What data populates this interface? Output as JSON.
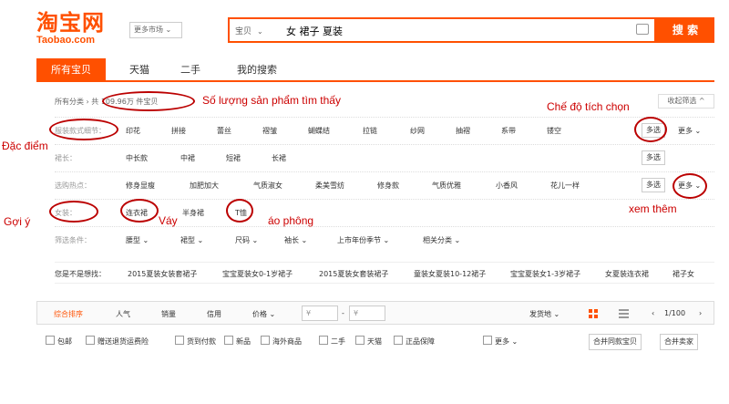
{
  "logo": {
    "cn": "淘宝网",
    "en": "Taobao.com"
  },
  "header": {
    "market": "更多市场 ⌄"
  },
  "search": {
    "category": "宝贝",
    "chevron": "⌄",
    "query": "女 裙子 夏装",
    "button": "搜 索"
  },
  "tabs": [
    "所有宝贝",
    "天猫",
    "二手",
    "我的搜索"
  ],
  "breadcrumb": {
    "all": "所有分类 ›",
    "count": "共 109.96万 件宝贝"
  },
  "collapse": "收起筛选 ^",
  "rows": {
    "r1": {
      "label": "服装款式细节：",
      "options": [
        "印花",
        "拼接",
        "蕾丝",
        "褶皱",
        "蝴蝶结",
        "拉链",
        "纱网",
        "抽褶",
        "系带",
        "镂空"
      ],
      "multi": "多选",
      "more": "更多 ⌄"
    },
    "r2": {
      "label": "裙长：",
      "options": [
        "中长款",
        "中裙",
        "短裙",
        "长裙"
      ],
      "multi": "多选"
    },
    "r3": {
      "label": "选购热点：",
      "options": [
        "修身显瘦",
        "加肥加大",
        "气质淑女",
        "柔美雪纺",
        "修身款",
        "气质优雅",
        "小香风",
        "花儿一样"
      ],
      "multi": "多选",
      "more": "更多 ⌄"
    },
    "r4": {
      "label": "女装：",
      "options": [
        "连衣裙",
        "半身裙",
        "T恤"
      ]
    },
    "r5": {
      "label": "筛选条件：",
      "options": [
        "腰型 ⌄",
        "裙型 ⌄",
        "尺码 ⌄",
        "袖长 ⌄",
        "上市年份季节 ⌄",
        "相关分类 ⌄"
      ]
    }
  },
  "guess": {
    "label": "您是不是想找：",
    "items": [
      "2015夏装女装套裙子",
      "宝宝夏装女0-1岁裙子",
      "2015夏装女套装裙子",
      "童装女夏装10-12裙子",
      "宝宝夏装女1-3岁裙子",
      "女夏装连衣裙",
      "裙子女"
    ]
  },
  "sort": {
    "items": [
      "综合排序",
      "人气",
      "销量",
      "信用",
      "价格 ⌄"
    ],
    "price_from": "¥",
    "price_to": "¥",
    "dash": "-",
    "ship": "发货地 ⌄",
    "page": "1/100",
    "prev": "‹",
    "next": "›"
  },
  "filters": {
    "items": [
      "包邮",
      "赠送退货运费险",
      "货到付款",
      "新品",
      "海外商品",
      "二手",
      "天猫",
      "正品保障"
    ],
    "more": "更多 ⌄",
    "merge1": "合并同款宝贝",
    "merge2": "合并卖家"
  },
  "annotations": {
    "count": "Số lượng sản phẩm tìm thấy",
    "multi": "Chế độ tích chọn",
    "features": "Đặc điểm",
    "suggest": "Gợi ý",
    "dress": "Váy",
    "tshirt": "áo phông",
    "more": "xem thêm"
  },
  "colors": {
    "brand": "#ff5000",
    "annotation": "#cc0000"
  }
}
